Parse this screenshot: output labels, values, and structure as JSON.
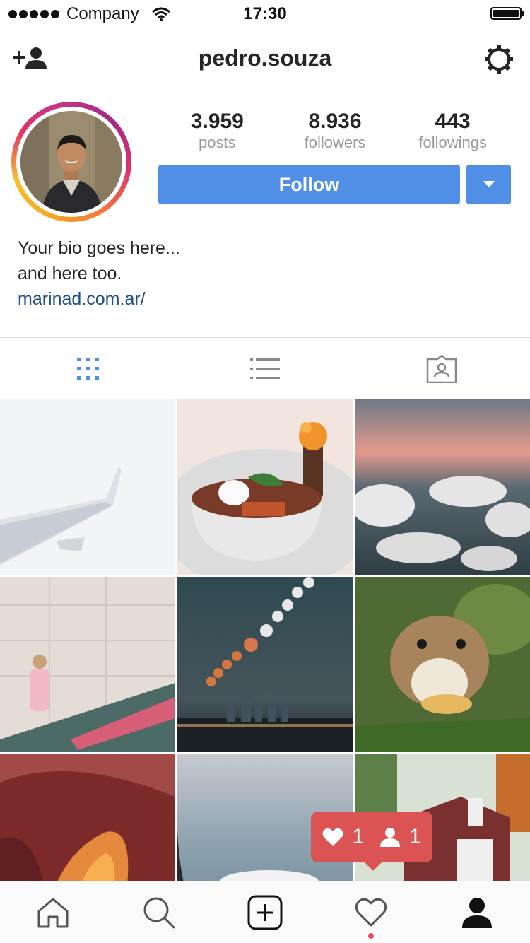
{
  "status_bar": {
    "carrier": "Company",
    "time": "17:30"
  },
  "header": {
    "username": "pedro.souza",
    "add_person_icon": "add-person-icon",
    "settings_icon": "gear-icon"
  },
  "profile": {
    "stats": [
      {
        "value": "3.959",
        "label": "posts"
      },
      {
        "value": "8.936",
        "label": "followers"
      },
      {
        "value": "443",
        "label": "followings"
      }
    ],
    "follow_label": "Follow",
    "bio_line1": "Your bio goes here...",
    "bio_line2": "and here too.",
    "link": "marinad.com.ar/"
  },
  "tabs": [
    {
      "icon": "grid-icon",
      "active": true
    },
    {
      "icon": "list-icon",
      "active": false
    },
    {
      "icon": "tagged-icon",
      "active": false
    }
  ],
  "grid_photos": [
    "airplane-wing-photo",
    "food-bowl-photo",
    "clouds-sunset-photo",
    "woman-wall-photo",
    "moon-phases-city-photo",
    "chipmunk-photo",
    "canyon-photo",
    "sky-window-photo",
    "barn-photo"
  ],
  "notification": {
    "likes": "1",
    "follows": "1"
  },
  "bottom_nav": [
    "home-icon",
    "search-icon",
    "add-post-icon",
    "heart-icon",
    "profile-icon"
  ],
  "colors": {
    "accent": "#4f90e6",
    "notification": "#dc5353",
    "link": "#1f4e8a"
  }
}
